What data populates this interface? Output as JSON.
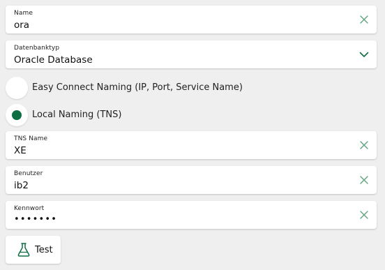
{
  "colors": {
    "accent": "#0e6e44",
    "icon_muted": "#5fa37f",
    "background": "#efefef"
  },
  "fields": {
    "name": {
      "label": "Name",
      "value": "ora",
      "icon": "clear-icon"
    },
    "dbtype": {
      "label": "Datenbanktyp",
      "value": "Oracle Database",
      "icon": "chevron-down-icon"
    },
    "tns": {
      "label": "TNS Name",
      "value": "XE",
      "icon": "clear-icon"
    },
    "user": {
      "label": "Benutzer",
      "value": "ib2",
      "icon": "clear-icon"
    },
    "password": {
      "label": "Kennwort",
      "value": "•••••••",
      "icon": "clear-icon"
    }
  },
  "naming": {
    "options": [
      {
        "label": "Easy Connect Naming (IP, Port, Service Name)",
        "selected": false
      },
      {
        "label": "Local Naming (TNS)",
        "selected": true
      }
    ]
  },
  "test_button": {
    "label": "Test",
    "icon": "flask-icon"
  }
}
